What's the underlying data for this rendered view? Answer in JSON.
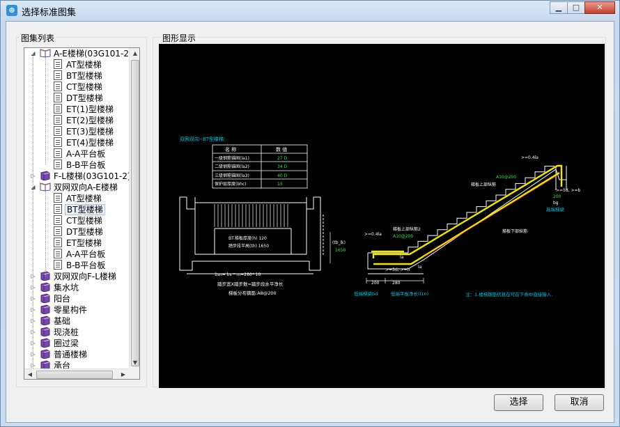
{
  "window": {
    "title": "选择标准图集",
    "min_label": "▁",
    "max_label": "□",
    "close_label": "✕"
  },
  "left_panel": {
    "label": "图集列表",
    "tree": [
      {
        "label": "A-E楼梯(03G101-2)",
        "level": 0,
        "icon": "open-book-icon",
        "state": "expanded"
      },
      {
        "label": "AT型楼梯",
        "level": 1,
        "icon": "document-icon"
      },
      {
        "label": "BT型楼梯",
        "level": 1,
        "icon": "document-icon"
      },
      {
        "label": "CT型楼梯",
        "level": 1,
        "icon": "document-icon"
      },
      {
        "label": "DT型楼梯",
        "level": 1,
        "icon": "document-icon"
      },
      {
        "label": "ET(1)型楼梯",
        "level": 1,
        "icon": "document-icon"
      },
      {
        "label": "ET(2)型楼梯",
        "level": 1,
        "icon": "document-icon"
      },
      {
        "label": "ET(3)型楼梯",
        "level": 1,
        "icon": "document-icon"
      },
      {
        "label": "ET(4)型楼梯",
        "level": 1,
        "icon": "document-icon"
      },
      {
        "label": "A-A平台板",
        "level": 1,
        "icon": "document-icon"
      },
      {
        "label": "B-B平台板",
        "level": 1,
        "icon": "document-icon"
      },
      {
        "label": "F-L楼梯(03G101-2)",
        "level": 0,
        "icon": "closed-book-icon",
        "state": "collapsed"
      },
      {
        "label": "双网双向A-E楼梯",
        "level": 0,
        "icon": "open-book-icon",
        "state": "expanded"
      },
      {
        "label": "AT型楼梯",
        "level": 1,
        "icon": "document-icon"
      },
      {
        "label": "BT型楼梯",
        "level": 1,
        "icon": "document-icon",
        "selected": true
      },
      {
        "label": "CT型楼梯",
        "level": 1,
        "icon": "document-icon"
      },
      {
        "label": "DT型楼梯",
        "level": 1,
        "icon": "document-icon"
      },
      {
        "label": "ET型楼梯",
        "level": 1,
        "icon": "document-icon"
      },
      {
        "label": "A-A平台板",
        "level": 1,
        "icon": "document-icon"
      },
      {
        "label": "B-B平台板",
        "level": 1,
        "icon": "document-icon"
      },
      {
        "label": "双网双向F-L楼梯",
        "level": 0,
        "icon": "closed-book-icon",
        "state": "collapsed"
      },
      {
        "label": "集水坑",
        "level": 0,
        "icon": "closed-book-icon",
        "state": "collapsed"
      },
      {
        "label": "阳台",
        "level": 0,
        "icon": "closed-book-icon",
        "state": "collapsed"
      },
      {
        "label": "零星构件",
        "level": 0,
        "icon": "closed-book-icon",
        "state": "collapsed"
      },
      {
        "label": "基础",
        "level": 0,
        "icon": "closed-book-icon",
        "state": "collapsed"
      },
      {
        "label": "现浇桩",
        "level": 0,
        "icon": "closed-book-icon",
        "state": "collapsed"
      },
      {
        "label": "圈过梁",
        "level": 0,
        "icon": "closed-book-icon",
        "state": "collapsed"
      },
      {
        "label": "普通楼梯",
        "level": 0,
        "icon": "closed-book-icon",
        "state": "collapsed"
      },
      {
        "label": "承台",
        "level": 0,
        "icon": "closed-book-icon",
        "state": "collapsed"
      }
    ]
  },
  "right_panel": {
    "label": "图形显示",
    "drawing": {
      "title": "双网双向--BT型楼梯:",
      "table_header": [
        "名 称",
        "数 值"
      ],
      "table_rows": [
        [
          "一级钢筋锚固(la1)",
          "27 D"
        ],
        [
          "二级钢筋锚固(la2)",
          "34 D"
        ],
        [
          "三级钢筋锚固(la3)",
          "40 D"
        ],
        [
          "保护层厚度(bhc)",
          "15"
        ]
      ],
      "plan_text_1": "BT.梯板厚度(h) 120",
      "plan_text_2": "踏步段半高(th) 1650",
      "plan_dim_1": "1sn= bs * m=280* 10",
      "plan_note_1": "踏步宽X踏步数=踏步段水平净长",
      "plan_note_2": "梯板分布钢筋:A8@200",
      "plan_side_1": "(tb_lk)",
      "plan_side_2": "1650",
      "sec_top_dim": ">=0.4la",
      "sec_bar_top": "A10@200",
      "sec_label_top": "梯板上部纵筋",
      "sec_label_top2": "梯板上部纵筋2",
      "sec_bar_mid": "A10@200",
      "sec_label_bottom": "梯板下部纵筋",
      "sec_left_dim": ">=0.4la",
      "sec_5d_left": ">=5d, >=h",
      "sec_5d_right": ">=5d, >=b",
      "sec_la_1": "la",
      "sec_la_2": "la",
      "sec_bg": "bg",
      "sec_200_right": "200",
      "sec_high_beam": "高端梯梁",
      "sec_dim_200": "200",
      "sec_dim_280": "280",
      "sec_low_beam": "低端梯梁bd",
      "sec_low_len": "低端平板净长(l1n)",
      "sec_note": "注：1.楼梯钢筋信息在可在下表中直接输入."
    }
  },
  "buttons": {
    "select": "选择",
    "cancel": "取消"
  }
}
